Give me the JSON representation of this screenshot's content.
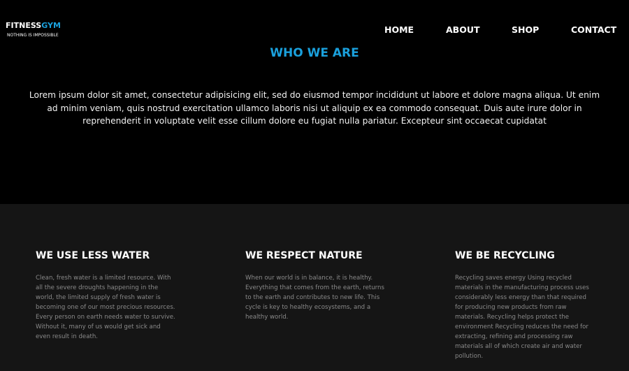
{
  "header": {
    "logo_main": "FITNESS",
    "logo_accent": "GYM",
    "logo_tagline": "NOTHING IS IMPOSSIBLE",
    "nav": {
      "home": "HOME",
      "about": "ABOUT",
      "shop": "SHOP",
      "contact": "CONTACT"
    }
  },
  "intro": {
    "title": "WHO WE ARE",
    "text": "Lorem ipsum dolor sit amet, consectetur adipisicing elit, sed do eiusmod tempor incididunt ut labore et dolore magna aliqua. Ut enim ad minim veniam, quis nostrud exercitation ullamco laboris nisi ut aliquip ex ea commodo consequat. Duis aute irure dolor in reprehenderit in voluptate velit esse cillum dolore eu fugiat nulla pariatur. Excepteur sint occaecat cupidatat"
  },
  "features": [
    {
      "title": "WE USE LESS WATER",
      "text": "Clean, fresh water is a limited resource. With all the severe droughts happening in the world, the limited supply of fresh water is becoming one of our most precious resources. Every person on earth needs water to survive. Without it, many of us would get sick and even result in death."
    },
    {
      "title": "WE RESPECT NATURE",
      "text": "When our world is in balance, it is healthy. Everything that comes from the earth, returns to the earth and contributes to new life. This cycle is key to healthy ecosystems, and a healthy world."
    },
    {
      "title": "WE BE RECYCLING",
      "text": "Recycling saves energy Using recycled materials in the manufacturing process uses considerably less energy than that required for producing new products from raw materials. Recycling helps protect the environment Recycling reduces the need for extracting, refining and processing raw materials all of which create air and water pollution."
    }
  ],
  "colors": {
    "accent": "#1aa0dc",
    "background": "#000000",
    "features_background": "#151515",
    "body_text": "#8a8a8a"
  }
}
